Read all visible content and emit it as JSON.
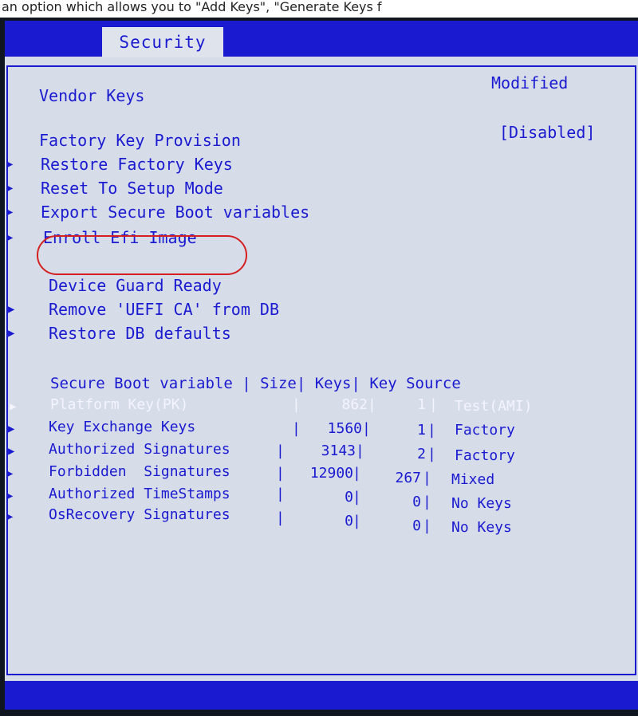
{
  "caption": "an option which allows you to \"Add Keys\", \"Generate Keys f",
  "tab": {
    "label": "Security"
  },
  "vendor_keys": {
    "label": "Vendor Keys",
    "value": "Modified"
  },
  "factory_key_provision": {
    "label": "Factory Key Provision",
    "value": "[Disabled]"
  },
  "menu": [
    {
      "label": "Restore Factory Keys"
    },
    {
      "label": "Reset To Setup Mode"
    },
    {
      "label": "Export Secure Boot variables"
    },
    {
      "label": "Enroll Efi Image"
    }
  ],
  "device_guard": {
    "label": "Device Guard Ready"
  },
  "device_menu": [
    {
      "label": "Remove 'UEFI CA' from DB"
    },
    {
      "label": "Restore DB defaults"
    }
  ],
  "table": {
    "header": "Secure Boot variable | Size| Keys| Key Source",
    "rows": [
      {
        "name": "Platform Key(PK)",
        "size": "862",
        "keys": "1",
        "source": "Test(AMI)",
        "selected": true
      },
      {
        "name": "Key Exchange Keys",
        "size": "1560",
        "keys": "1",
        "source": "Factory"
      },
      {
        "name": "Authorized Signatures",
        "size": "3143",
        "keys": "2",
        "source": "Factory"
      },
      {
        "name": "Forbidden  Signatures",
        "size": "12900",
        "keys": "267",
        "source": "Mixed"
      },
      {
        "name": "Authorized TimeStamps",
        "size": "0",
        "keys": "0",
        "source": "No Keys"
      },
      {
        "name": "OsRecovery Signatures",
        "size": "0",
        "keys": "0",
        "source": "No Keys"
      }
    ]
  },
  "colors": {
    "text": "#1a1ad0",
    "background": "#d6dce8",
    "highlight": "#f4f4ff",
    "annotation": "#d42020"
  },
  "icons": {
    "submenu": "triangle-right-icon"
  }
}
